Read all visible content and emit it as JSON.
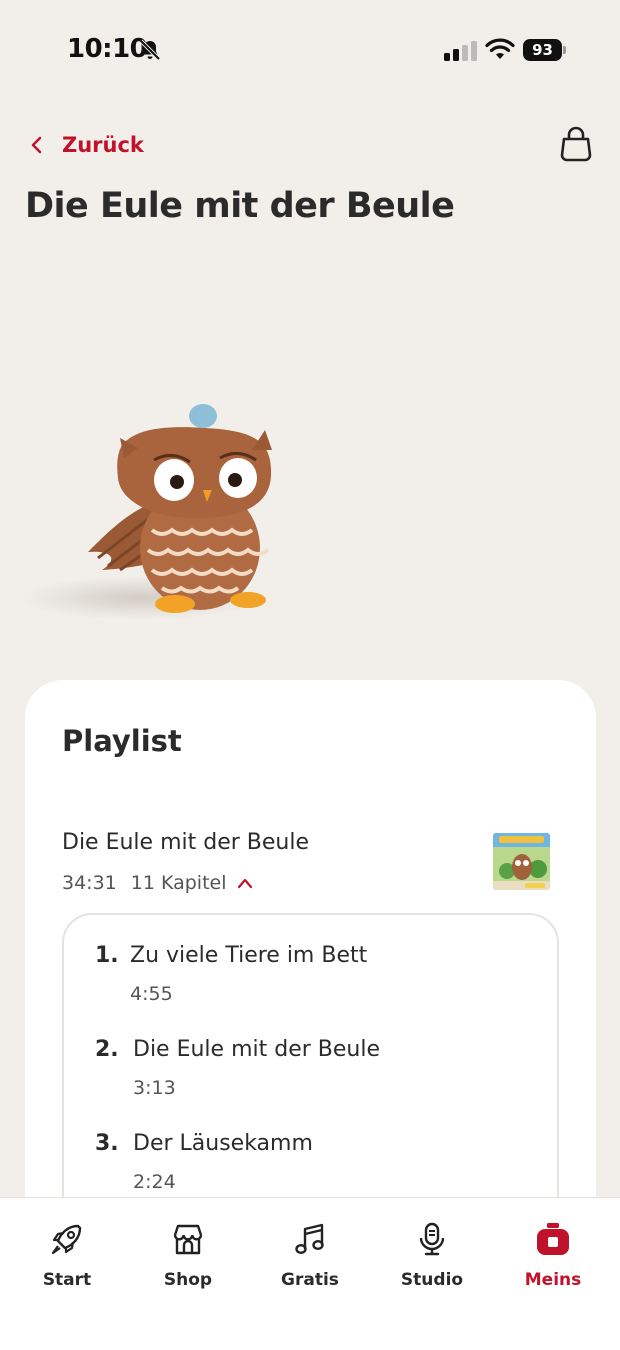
{
  "status_bar": {
    "time": "10:10",
    "battery": "93"
  },
  "nav": {
    "back_label": "Zurück"
  },
  "page": {
    "title": "Die Eule mit der Beule"
  },
  "playlist": {
    "heading": "Playlist",
    "album": {
      "title": "Die Eule mit der Beule",
      "duration": "34:31",
      "chapter_count": "11 Kapitel"
    },
    "chapters": [
      {
        "num": "1.",
        "title": "Zu viele Tiere im Bett",
        "duration": "4:55"
      },
      {
        "num": "2.",
        "title": "Die Eule mit der Beule",
        "duration": "3:13"
      },
      {
        "num": "3.",
        "title": "Der Läusekamm",
        "duration": "2:24"
      }
    ]
  },
  "tabs": [
    {
      "label": "Start",
      "icon": "rocket-icon"
    },
    {
      "label": "Shop",
      "icon": "store-icon"
    },
    {
      "label": "Gratis",
      "icon": "music-note-icon"
    },
    {
      "label": "Studio",
      "icon": "microphone-icon"
    },
    {
      "label": "Meins",
      "icon": "toniebox-icon",
      "active": true
    }
  ],
  "colors": {
    "accent": "#c0132b",
    "background": "#f2efeb",
    "card": "#ffffff"
  }
}
